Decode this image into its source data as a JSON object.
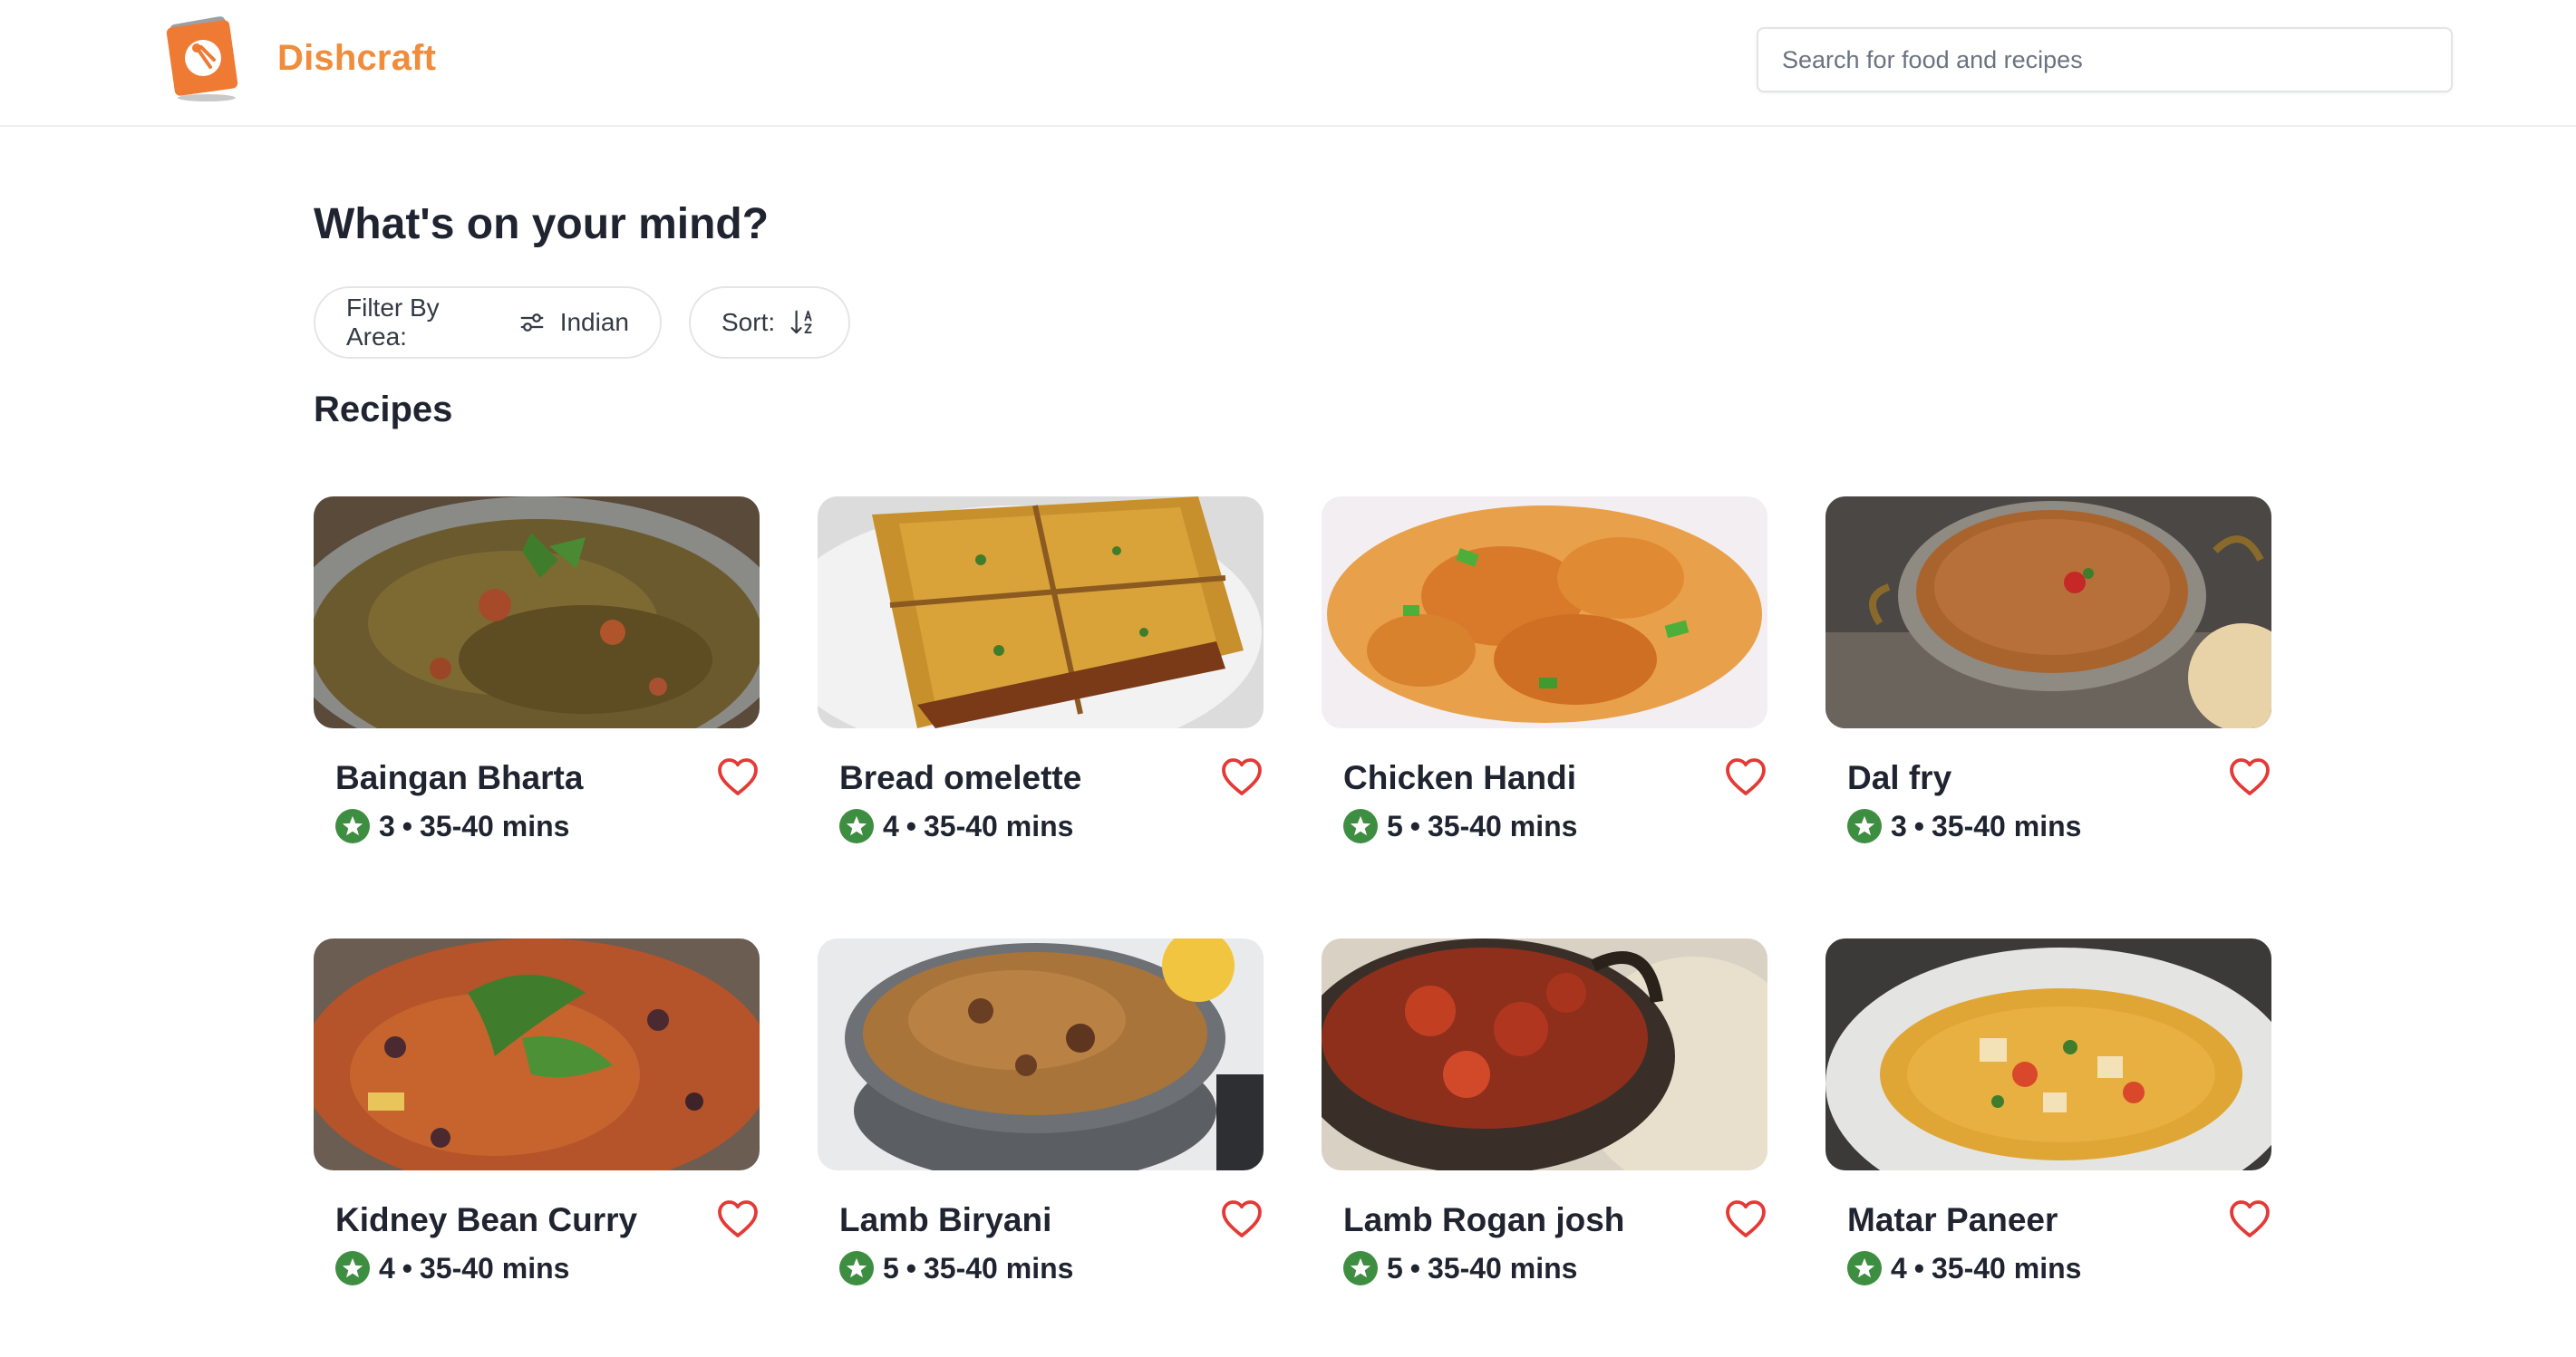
{
  "header": {
    "brand": "Dishcraft",
    "search_placeholder": "Search for food and recipes"
  },
  "main": {
    "heading": "What's on your mind?",
    "filter": {
      "label": "Filter By Area:",
      "value": "Indian"
    },
    "sort": {
      "label": "Sort:"
    },
    "section_title": "Recipes"
  },
  "recipes": [
    {
      "name": "Baingan Bharta",
      "rating": "3",
      "time": "35-40 mins"
    },
    {
      "name": "Bread omelette",
      "rating": "4",
      "time": "35-40 mins"
    },
    {
      "name": "Chicken Handi",
      "rating": "5",
      "time": "35-40 mins"
    },
    {
      "name": "Dal fry",
      "rating": "3",
      "time": "35-40 mins"
    },
    {
      "name": "Kidney Bean Curry",
      "rating": "4",
      "time": "35-40 mins"
    },
    {
      "name": "Lamb Biryani",
      "rating": "5",
      "time": "35-40 mins"
    },
    {
      "name": "Lamb Rogan josh",
      "rating": "5",
      "time": "35-40 mins"
    },
    {
      "name": "Matar Paneer",
      "rating": "4",
      "time": "35-40 mins"
    }
  ],
  "colors": {
    "brand": "#f08c3c",
    "heart": "#e53935",
    "star": "#3e8e41",
    "text": "#1f2430"
  },
  "icons": {
    "logo": "recipe-book-logo-icon",
    "filter": "sliders-icon",
    "sort": "sort-az-icon",
    "favorite": "heart-outline-icon",
    "rating": "star-badge-icon"
  }
}
